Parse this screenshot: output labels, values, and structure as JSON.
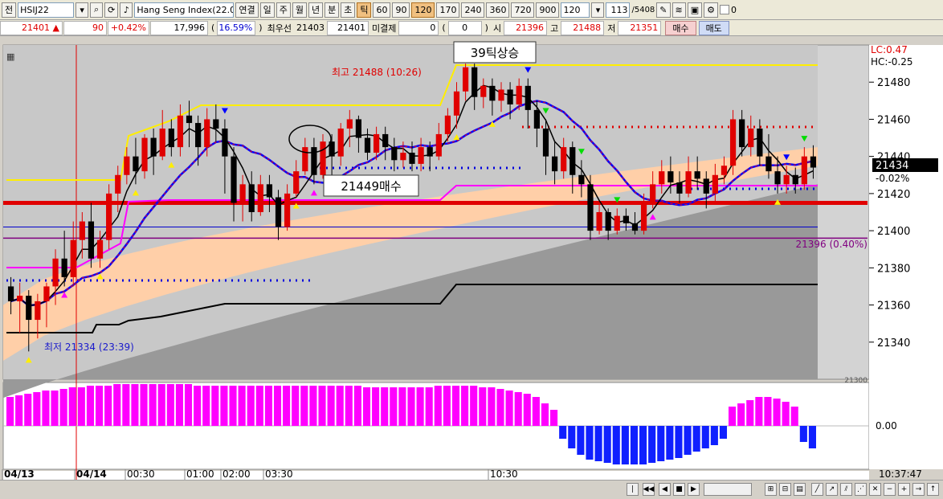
{
  "toolbar": {
    "jeon": "전",
    "symbol": "HSIJ22",
    "index_name": "Hang Seng Index(22.0",
    "buttons": [
      "연결",
      "일",
      "주",
      "월",
      "년",
      "분",
      "초",
      "틱"
    ],
    "selected": "틱",
    "periods": [
      "60",
      "90",
      "120",
      "170",
      "240",
      "360",
      "720",
      "900"
    ],
    "selected_period": "120",
    "period_value": "120",
    "count": "113",
    "count_total": "/5408",
    "zero_label": "0"
  },
  "quote": {
    "price": "21401",
    "arrow": "▲",
    "change": "90",
    "change_pct": "+0.42%",
    "volume": "17,996",
    "volume_pct": "16.59%",
    "best_label": "최우선",
    "best_price": "21403",
    "last": "21401",
    "unsettled_label": "미결제",
    "unsettled": "0",
    "unsettled_paren": "0",
    "open_label": "시",
    "open": "21396",
    "high_label": "고",
    "high": "21488",
    "low_label": "저",
    "low": "21351",
    "buy": "매수",
    "sell": "매도"
  },
  "annotations": {
    "high_text": "최고 21488 (10:26)",
    "low_text": "최저 21334 (23:39)",
    "rise_box": "39틱상승",
    "buy_box": "21449매수",
    "lc": "LC:0.47",
    "hc": "HC:-0.25",
    "current_price": "21434",
    "current_pct": "-0.02%",
    "purple_level": "21396 (0.40%)",
    "hidden_label": "21300",
    "osc_zero": "0.00",
    "time": "10:37:47"
  },
  "chart_data": {
    "type": "candlestick",
    "yaxis": {
      "ticks": [
        21340,
        21360,
        21380,
        21400,
        21420,
        21440,
        21460,
        21480
      ],
      "range": [
        21320,
        21500
      ]
    },
    "xaxis": {
      "ticks": [
        "04/13",
        "04/14",
        "00:30",
        "01:00",
        "02:00",
        "03:30",
        "10:30"
      ]
    },
    "levels": {
      "red_line": 21415,
      "purple_line": 21396,
      "blue_line": 21402
    },
    "candles": [
      [
        21370,
        21362,
        21375,
        21355
      ],
      [
        21362,
        21365,
        21372,
        21345
      ],
      [
        21365,
        21352,
        21368,
        21335
      ],
      [
        21352,
        21362,
        21366,
        21342
      ],
      [
        21362,
        21370,
        21372,
        21348
      ],
      [
        21370,
        21385,
        21390,
        21360
      ],
      [
        21385,
        21375,
        21400,
        21370
      ],
      [
        21375,
        21395,
        21405,
        21370
      ],
      [
        21395,
        21405,
        21410,
        21385
      ],
      [
        21405,
        21385,
        21415,
        21380
      ],
      [
        21385,
        21395,
        21400,
        21380
      ],
      [
        21395,
        21420,
        21425,
        21390
      ],
      [
        21420,
        21430,
        21435,
        21410
      ],
      [
        21430,
        21440,
        21445,
        21425
      ],
      [
        21440,
        21432,
        21450,
        21425
      ],
      [
        21432,
        21450,
        21452,
        21428
      ],
      [
        21450,
        21440,
        21455,
        21430
      ],
      [
        21440,
        21455,
        21465,
        21438
      ],
      [
        21455,
        21445,
        21460,
        21440
      ],
      [
        21445,
        21462,
        21468,
        21440
      ],
      [
        21462,
        21458,
        21470,
        21445
      ],
      [
        21458,
        21445,
        21462,
        21435
      ],
      [
        21445,
        21460,
        21466,
        21440
      ],
      [
        21460,
        21455,
        21468,
        21448
      ],
      [
        21455,
        21440,
        21460,
        21420
      ],
      [
        21440,
        21415,
        21445,
        21405
      ],
      [
        21415,
        21425,
        21430,
        21405
      ],
      [
        21425,
        21410,
        21432,
        21405
      ],
      [
        21410,
        21425,
        21430,
        21408
      ],
      [
        21425,
        21418,
        21430,
        21410
      ],
      [
        21418,
        21402,
        21422,
        21395
      ],
      [
        21402,
        21420,
        21425,
        21400
      ],
      [
        21420,
        21432,
        21438,
        21418
      ],
      [
        21432,
        21445,
        21450,
        21430
      ],
      [
        21445,
        21430,
        21450,
        21425
      ],
      [
        21430,
        21448,
        21452,
        21428
      ],
      [
        21448,
        21440,
        21452,
        21430
      ],
      [
        21440,
        21455,
        21458,
        21435
      ],
      [
        21455,
        21460,
        21465,
        21445
      ],
      [
        21460,
        21450,
        21462,
        21442
      ],
      [
        21450,
        21442,
        21455,
        21438
      ],
      [
        21442,
        21452,
        21456,
        21438
      ],
      [
        21452,
        21445,
        21456,
        21438
      ],
      [
        21445,
        21438,
        21450,
        21432
      ],
      [
        21438,
        21442,
        21448,
        21434
      ],
      [
        21442,
        21436,
        21448,
        21432
      ],
      [
        21436,
        21445,
        21450,
        21432
      ],
      [
        21445,
        21440,
        21448,
        21432
      ],
      [
        21440,
        21452,
        21458,
        21438
      ],
      [
        21452,
        21462,
        21466,
        21448
      ],
      [
        21462,
        21475,
        21480,
        21455
      ],
      [
        21475,
        21488,
        21490,
        21470
      ],
      [
        21488,
        21472,
        21490,
        21465
      ],
      [
        21472,
        21478,
        21482,
        21466
      ],
      [
        21478,
        21470,
        21482,
        21462
      ],
      [
        21470,
        21476,
        21480,
        21464
      ],
      [
        21476,
        21468,
        21480,
        21460
      ],
      [
        21468,
        21478,
        21482,
        21465
      ],
      [
        21478,
        21465,
        21482,
        21455
      ],
      [
        21465,
        21455,
        21470,
        21445
      ],
      [
        21455,
        21440,
        21460,
        21430
      ],
      [
        21440,
        21432,
        21448,
        21425
      ],
      [
        21432,
        21445,
        21450,
        21428
      ],
      [
        21445,
        21430,
        21448,
        21420
      ],
      [
        21430,
        21425,
        21438,
        21418
      ],
      [
        21425,
        21400,
        21430,
        21395
      ],
      [
        21400,
        21410,
        21415,
        21398
      ],
      [
        21410,
        21400,
        21412,
        21395
      ],
      [
        21400,
        21408,
        21412,
        21398
      ],
      [
        21408,
        21404,
        21412,
        21400
      ],
      [
        21404,
        21400,
        21410,
        21398
      ],
      [
        21400,
        21415,
        21420,
        21398
      ],
      [
        21415,
        21425,
        21432,
        21412
      ],
      [
        21425,
        21432,
        21438,
        21420
      ],
      [
        21432,
        21426,
        21440,
        21420
      ],
      [
        21426,
        21420,
        21432,
        21415
      ],
      [
        21420,
        21432,
        21440,
        21418
      ],
      [
        21432,
        21428,
        21440,
        21422
      ],
      [
        21428,
        21420,
        21432,
        21412
      ],
      [
        21420,
        21430,
        21436,
        21416
      ],
      [
        21430,
        21435,
        21440,
        21425
      ],
      [
        21435,
        21460,
        21465,
        21430
      ],
      [
        21460,
        21445,
        21465,
        21440
      ],
      [
        21445,
        21455,
        21462,
        21440
      ],
      [
        21455,
        21440,
        21460,
        21435
      ],
      [
        21440,
        21432,
        21452,
        21428
      ],
      [
        21432,
        21425,
        21440,
        21420
      ],
      [
        21425,
        21430,
        21435,
        21420
      ],
      [
        21430,
        21425,
        21434,
        21420
      ],
      [
        21425,
        21440,
        21445,
        21422
      ],
      [
        21440,
        21434,
        21446,
        21428
      ]
    ],
    "oscillator": [
      18,
      19,
      20,
      21,
      22,
      22,
      23,
      24,
      24,
      25,
      25,
      25,
      26,
      26,
      26,
      26,
      26,
      26,
      26,
      26,
      26,
      25,
      25,
      25,
      25,
      25,
      25,
      25,
      25,
      25,
      25,
      25,
      25,
      25,
      25,
      25,
      25,
      25,
      25,
      25,
      24,
      24,
      24,
      24,
      24,
      24,
      24,
      24,
      25,
      25,
      25,
      25,
      25,
      24,
      24,
      23,
      22,
      21,
      20,
      18,
      14,
      10,
      -8,
      -14,
      -18,
      -21,
      -22,
      -23,
      -24,
      -24,
      -24,
      -24,
      -23,
      -22,
      -21,
      -20,
      -18,
      -16,
      -14,
      -12,
      -8,
      12,
      14,
      16,
      18,
      18,
      17,
      15,
      12,
      -10,
      -14
    ]
  }
}
